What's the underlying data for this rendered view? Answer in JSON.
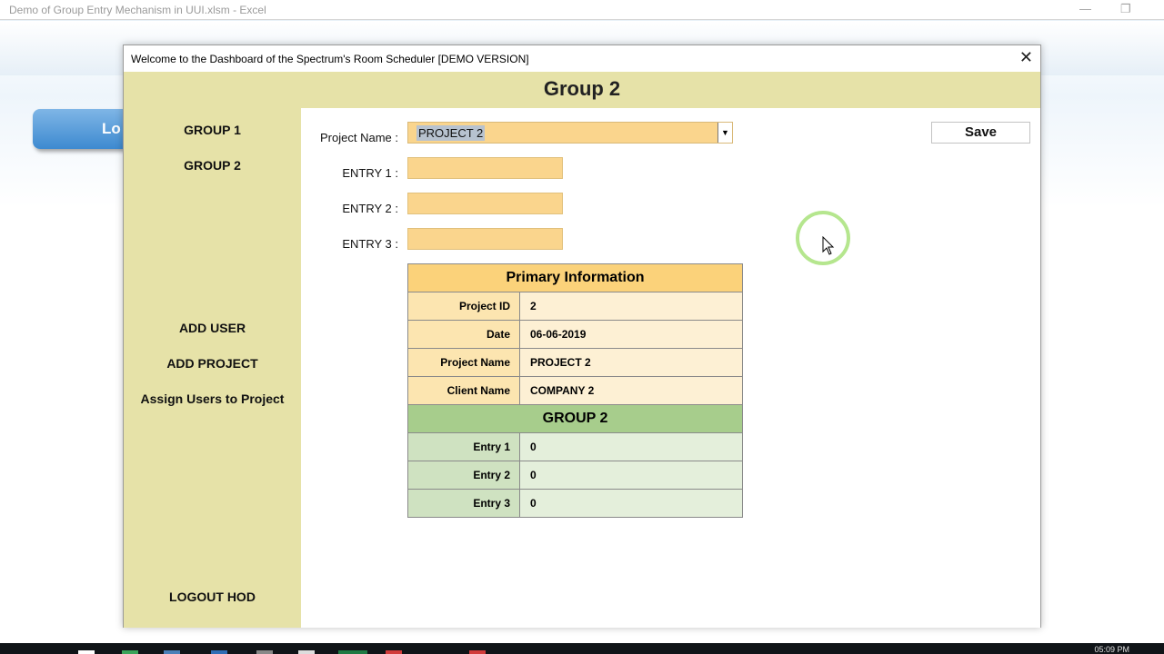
{
  "excel": {
    "window_title": "Demo of Group Entry Mechanism in UUI.xlsm - Excel",
    "login_button_partial": "Lo",
    "clock": "05:09 PM"
  },
  "dialog": {
    "title": "Welcome to the Dashboard of the Spectrum's Room Scheduler [DEMO VERSION]",
    "close_label": "✕",
    "header": "Group 2"
  },
  "sidebar": {
    "items": [
      {
        "label": "GROUP 1"
      },
      {
        "label": "GROUP 2"
      },
      {
        "label": "ADD USER"
      },
      {
        "label": "ADD PROJECT"
      },
      {
        "label": "Assign Users to Project"
      },
      {
        "label": "LOGOUT HOD"
      }
    ]
  },
  "form": {
    "project_name_label": "Project Name :",
    "project_name_value": "PROJECT 2",
    "entry1_label": "ENTRY 1 :",
    "entry2_label": "ENTRY 2 :",
    "entry3_label": "ENTRY 3 :",
    "entry1_value": "",
    "entry2_value": "",
    "entry3_value": "",
    "save_label": "Save"
  },
  "info": {
    "primary_title": "Primary Information",
    "primary_rows": [
      {
        "key": "Project ID",
        "value": "2"
      },
      {
        "key": "Date",
        "value": "06-06-2019"
      },
      {
        "key": "Project Name",
        "value": "PROJECT 2"
      },
      {
        "key": "Client Name",
        "value": "COMPANY 2"
      }
    ],
    "group_title": "GROUP 2",
    "group_rows": [
      {
        "key": "Entry 1",
        "value": "0"
      },
      {
        "key": "Entry 2",
        "value": "0"
      },
      {
        "key": "Entry 3",
        "value": "0"
      }
    ]
  },
  "colors": {
    "sidebar_bg": "#e6e2a8",
    "input_bg": "#fad58d",
    "primary_header": "#fbd27a",
    "group_header": "#a7cd8c"
  }
}
